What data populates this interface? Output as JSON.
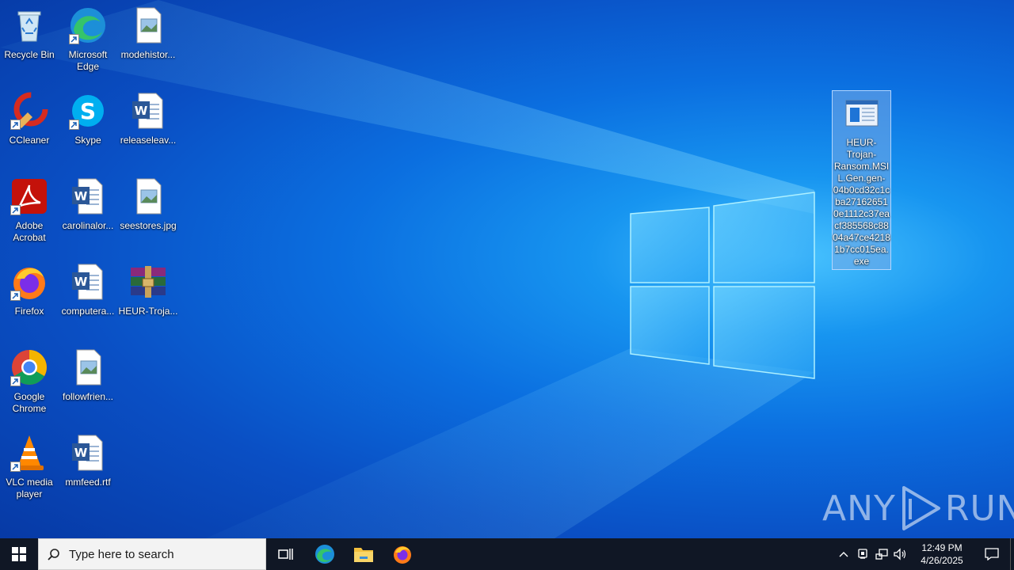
{
  "desktop": {
    "icons": [
      {
        "label": "Recycle Bin"
      },
      {
        "label": "Microsoft Edge"
      },
      {
        "label": "modehistor..."
      },
      {
        "label": "CCleaner"
      },
      {
        "label": "Skype"
      },
      {
        "label": "releaseleav..."
      },
      {
        "label": "Adobe Acrobat"
      },
      {
        "label": "carolinalor..."
      },
      {
        "label": "seestores.jpg"
      },
      {
        "label": "Firefox"
      },
      {
        "label": "computera..."
      },
      {
        "label": "HEUR-Troja..."
      },
      {
        "label": "Google Chrome"
      },
      {
        "label": "followfrien..."
      },
      {
        "label": "VLC media player"
      },
      {
        "label": "mmfeed.rtf"
      }
    ],
    "selected_file": {
      "label": "HEUR-Trojan-Ransom.MSIL.Gen.gen-04b0cd32c1cba271626510e1112c37eacf385568c8804a47ce42181b7cc015ea.exe"
    },
    "watermark": {
      "left": "ANY",
      "right": "RUN"
    }
  },
  "taskbar": {
    "search_placeholder": "Type here to search",
    "clock_time": "12:49 PM",
    "clock_date": "4/26/2025"
  },
  "colors": {
    "taskbar_bg": "#101725",
    "desktop_accent": "#1795f0"
  }
}
